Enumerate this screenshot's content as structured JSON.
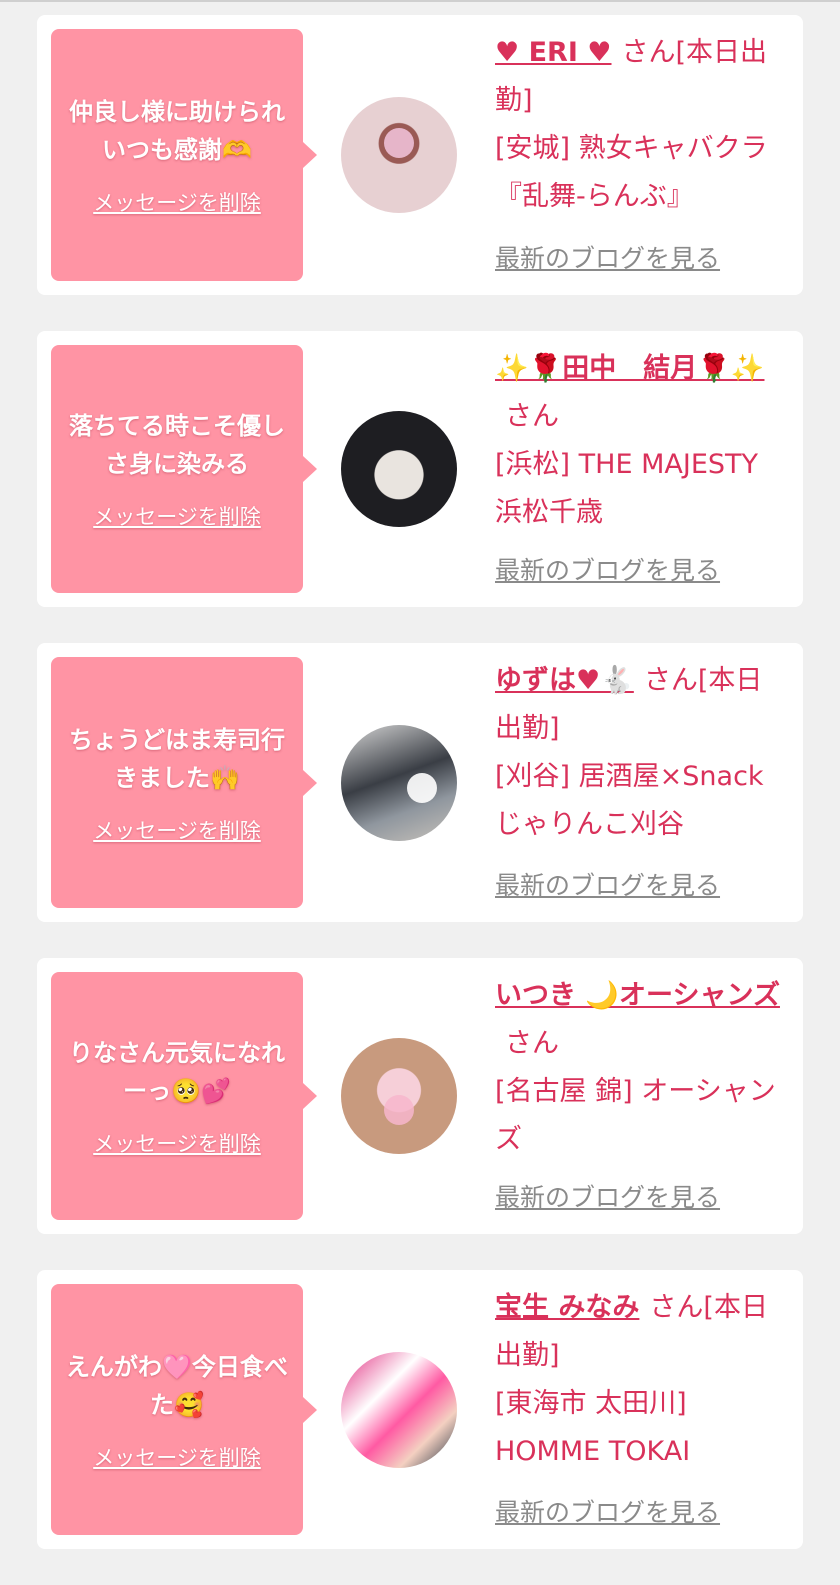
{
  "delete_label": "メッセージを削除",
  "blog_label": "最新のブログを見る",
  "colors": {
    "accent": "#d9315a",
    "bubble": "#ff94a4",
    "background": "#f0f0f0",
    "card": "#ffffff",
    "link_gray": "#8a8a8a"
  },
  "cards": [
    {
      "message": "仲良し様に助けられいつも感謝🫶",
      "name": "♥ ERI ♥",
      "honorific": "さん",
      "status": "[本日出勤]",
      "store": "[安城] 熟女キャバクラ『乱舞-らんぶ』",
      "avatar_icon": "woman-selfie-avatar"
    },
    {
      "message": "落ちてる時こそ優しさ身に染みる",
      "name": "✨🌹田中　結月🌹✨",
      "honorific": "さん",
      "status": "",
      "store": "[浜松] THE MAJESTY 浜松千歳",
      "avatar_icon": "woman-portrait-avatar"
    },
    {
      "message": "ちょうどはま寿司行きました🙌",
      "name": "ゆずは♥🐇",
      "honorific": "さん",
      "status": "[本日出勤]",
      "store": "[刈谷] 居酒屋×Snack じゃりんこ刈谷",
      "avatar_icon": "sushi-restaurant-avatar"
    },
    {
      "message": "りなさん元気になれーっ🥺💕",
      "name": "いつき 🌙オーシャンズ",
      "honorific": "さん",
      "status": "",
      "store": "[名古屋 錦] オーシャンズ",
      "avatar_icon": "woman-closeup-avatar"
    },
    {
      "message": "えんがわ🩷今日食べた🥰",
      "name": "宝生 みなみ",
      "honorific": "さん",
      "status": "[本日出勤]",
      "store": "[東海市 太田川] HOMME TOKAI",
      "avatar_icon": "pink-room-avatar"
    }
  ]
}
